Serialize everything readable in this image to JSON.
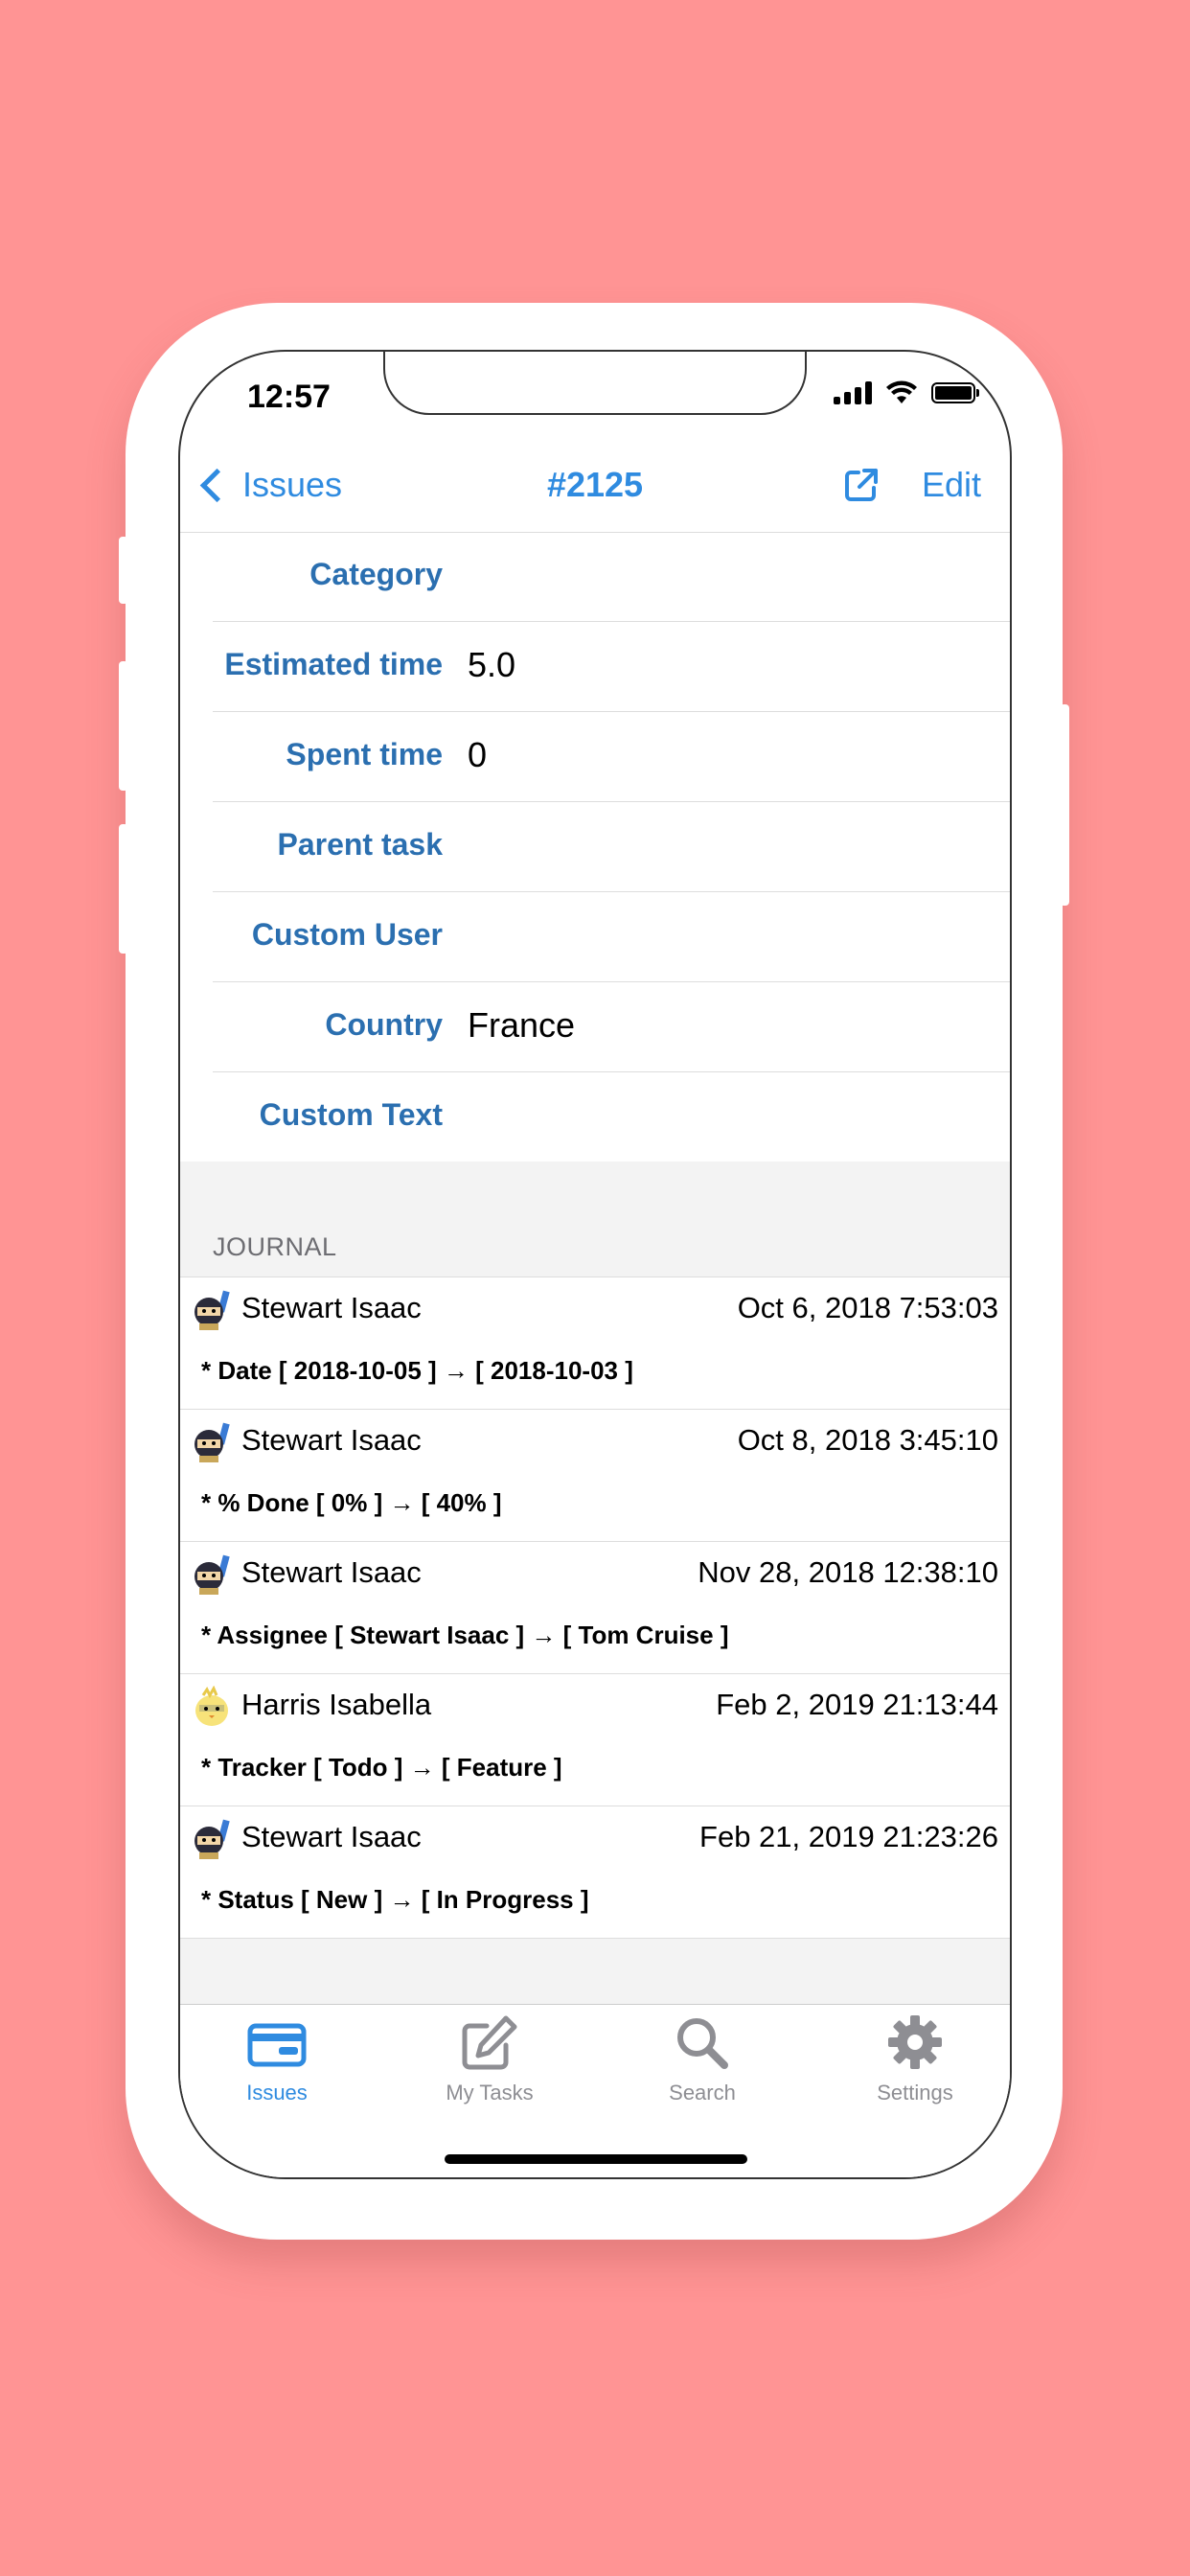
{
  "colors": {
    "background": "#FF9494",
    "accent": "#2F8BE0",
    "label": "#2B6FB0",
    "inactive": "#8E8E93"
  },
  "status_bar": {
    "time": "12:57"
  },
  "navbar": {
    "back_label": "Issues",
    "title": "#2125",
    "share_icon": "share-icon",
    "edit_label": "Edit"
  },
  "fields": [
    {
      "label": "Category",
      "value": ""
    },
    {
      "label": "Estimated time",
      "value": "5.0"
    },
    {
      "label": "Spent time",
      "value": "0"
    },
    {
      "label": "Parent task",
      "value": ""
    },
    {
      "label": "Custom User",
      "value": ""
    },
    {
      "label": "Country",
      "value": "France"
    },
    {
      "label": "Custom Text",
      "value": ""
    }
  ],
  "journal": {
    "header": "JOURNAL",
    "entries": [
      {
        "user": "Stewart Isaac",
        "date": "Oct 6, 2018 7:53:03",
        "detail": "* Date  [ 2018-10-05 ] → [ 2018-10-03 ]",
        "avatar": "ninja-avatar"
      },
      {
        "user": "Stewart Isaac",
        "date": "Oct 8, 2018 3:45:10",
        "detail": "* % Done  [ 0% ] → [ 40% ]",
        "avatar": "ninja-avatar"
      },
      {
        "user": "Stewart Isaac",
        "date": "Nov 28, 2018 12:38:10",
        "detail": "* Assignee  [ Stewart Isaac ] → [ Tom Cruise ]",
        "avatar": "ninja-avatar"
      },
      {
        "user": "Harris Isabella",
        "date": "Feb 2, 2019 21:13:44",
        "detail": "* Tracker  [ Todo ] → [ Feature ]",
        "avatar": "chick-avatar"
      },
      {
        "user": "Stewart Isaac",
        "date": "Feb 21, 2019 21:23:26",
        "detail": "* Status  [ New ] → [ In Progress ]",
        "avatar": "ninja-avatar"
      }
    ]
  },
  "tabbar": {
    "tabs": [
      {
        "label": "Issues",
        "icon": "card-icon",
        "active": true
      },
      {
        "label": "My Tasks",
        "icon": "edit-icon",
        "active": false
      },
      {
        "label": "Search",
        "icon": "search-icon",
        "active": false
      },
      {
        "label": "Settings",
        "icon": "gear-icon",
        "active": false
      }
    ]
  }
}
